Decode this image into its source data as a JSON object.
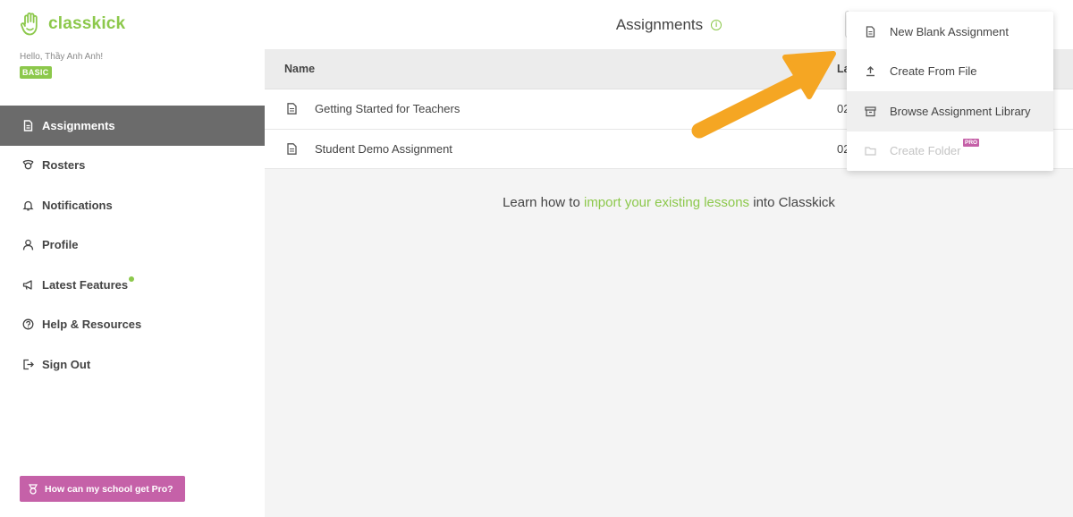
{
  "app": {
    "brand": "classkick",
    "greeting": "Hello, Thầy Anh Anh!",
    "plan": "BASIC",
    "brand_color": "#8cc84b",
    "pro_color": "#c561a8"
  },
  "sidebar": {
    "items": [
      {
        "label": "Assignments",
        "icon": "document-icon",
        "active": true
      },
      {
        "label": "Rosters",
        "icon": "rosters-icon",
        "active": false
      },
      {
        "label": "Notifications",
        "icon": "bell-icon",
        "active": false
      },
      {
        "label": "Profile",
        "icon": "person-icon",
        "active": false
      },
      {
        "label": "Latest Features",
        "icon": "megaphone-icon",
        "active": false,
        "badge_dot": true
      },
      {
        "label": "Help & Resources",
        "icon": "help-icon",
        "active": false
      },
      {
        "label": "Sign Out",
        "icon": "sign-out-icon",
        "active": false
      }
    ],
    "pro_button": "How can my school get Pro?"
  },
  "header": {
    "title": "Assignments",
    "info_icon": "info-icon"
  },
  "table": {
    "columns": [
      "Name",
      "La"
    ],
    "rows": [
      {
        "name": "Getting Started for Teachers",
        "date": "02"
      },
      {
        "name": "Student Demo Assignment",
        "date": "02"
      }
    ]
  },
  "learn": {
    "prefix": "Learn how to ",
    "link": "import your existing lessons",
    "suffix": " into Classkick"
  },
  "dropdown": {
    "items": [
      {
        "label": "New Blank Assignment",
        "icon": "document-icon",
        "state": "normal"
      },
      {
        "label": "Create From File",
        "icon": "upload-icon",
        "state": "normal"
      },
      {
        "label": "Browse Assignment Library",
        "icon": "library-icon",
        "state": "hover"
      },
      {
        "label": "Create Folder",
        "icon": "folder-icon",
        "state": "disabled",
        "tag": "PRO"
      }
    ]
  },
  "annotation": {
    "arrow_color": "#f5a623"
  }
}
